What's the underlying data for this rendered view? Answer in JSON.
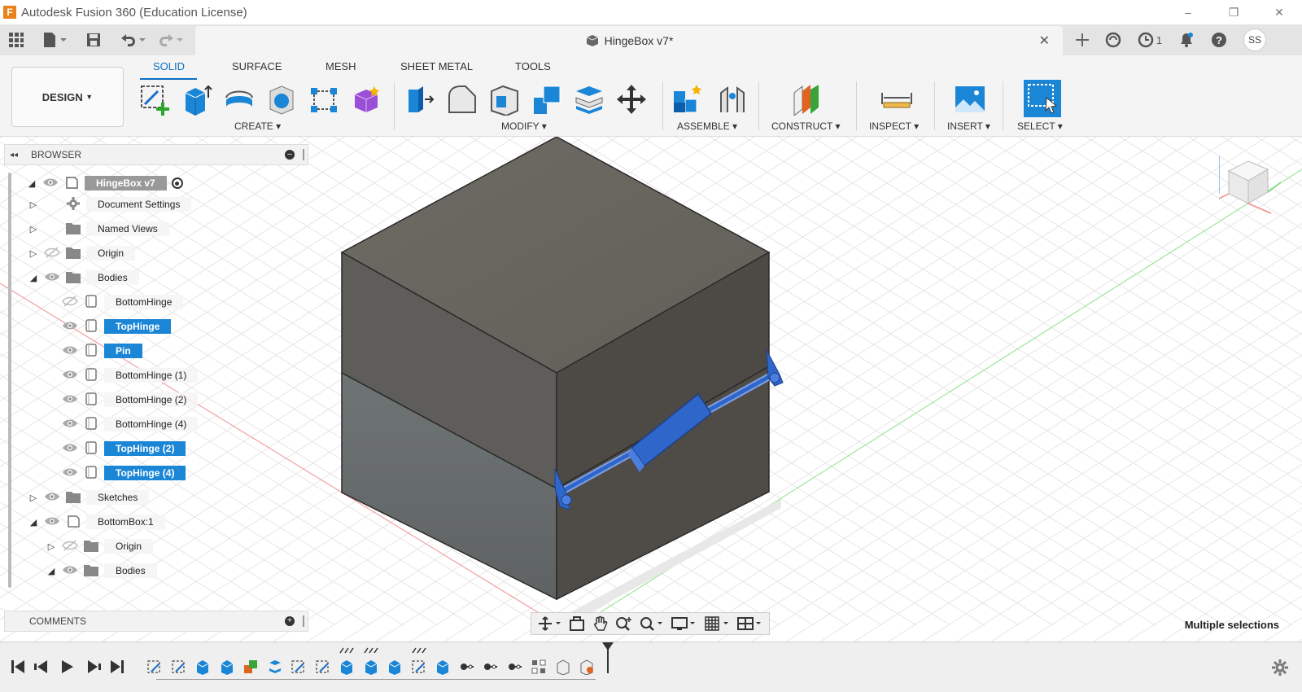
{
  "window": {
    "logo_letter": "F",
    "title": "Autodesk Fusion 360 (Education License)",
    "controls": [
      "–",
      "❐",
      "✕"
    ]
  },
  "tabbar": {
    "document_tab": "HingeBox v7*",
    "close": "✕",
    "jobs_count": "1",
    "user_initials": "SS"
  },
  "ribbon": {
    "workspace": "DESIGN",
    "tabs": [
      "SOLID",
      "SURFACE",
      "MESH",
      "SHEET METAL",
      "TOOLS"
    ],
    "active_tab": "SOLID",
    "groups": {
      "create": "CREATE",
      "modify": "MODIFY",
      "assemble": "ASSEMBLE",
      "construct": "CONSTRUCT",
      "inspect": "INSPECT",
      "insert": "INSERT",
      "select": "SELECT"
    }
  },
  "browser": {
    "title": "BROWSER",
    "root": "HingeBox v7",
    "items": [
      {
        "label": "Document Settings"
      },
      {
        "label": "Named Views"
      },
      {
        "label": "Origin"
      },
      {
        "label": "Bodies"
      },
      {
        "label": "BottomHinge"
      },
      {
        "label": "TopHinge"
      },
      {
        "label": "Pin"
      },
      {
        "label": "BottomHinge (1)"
      },
      {
        "label": "BottomHinge (2)"
      },
      {
        "label": "BottomHinge (4)"
      },
      {
        "label": "TopHinge (2)"
      },
      {
        "label": "TopHinge (4)"
      },
      {
        "label": "Sketches"
      },
      {
        "label": "BottomBox:1"
      },
      {
        "label": "Origin"
      },
      {
        "label": "Bodies"
      }
    ]
  },
  "comments": {
    "title": "COMMENTS"
  },
  "status": {
    "selection": "Multiple selections"
  },
  "colors": {
    "accent": "#1b86d6",
    "selected_body": "#2f66c9",
    "box_top": "#6b6862",
    "box_front_upper": "#5f5e5b",
    "box_side_upper": "#4f4c47"
  }
}
